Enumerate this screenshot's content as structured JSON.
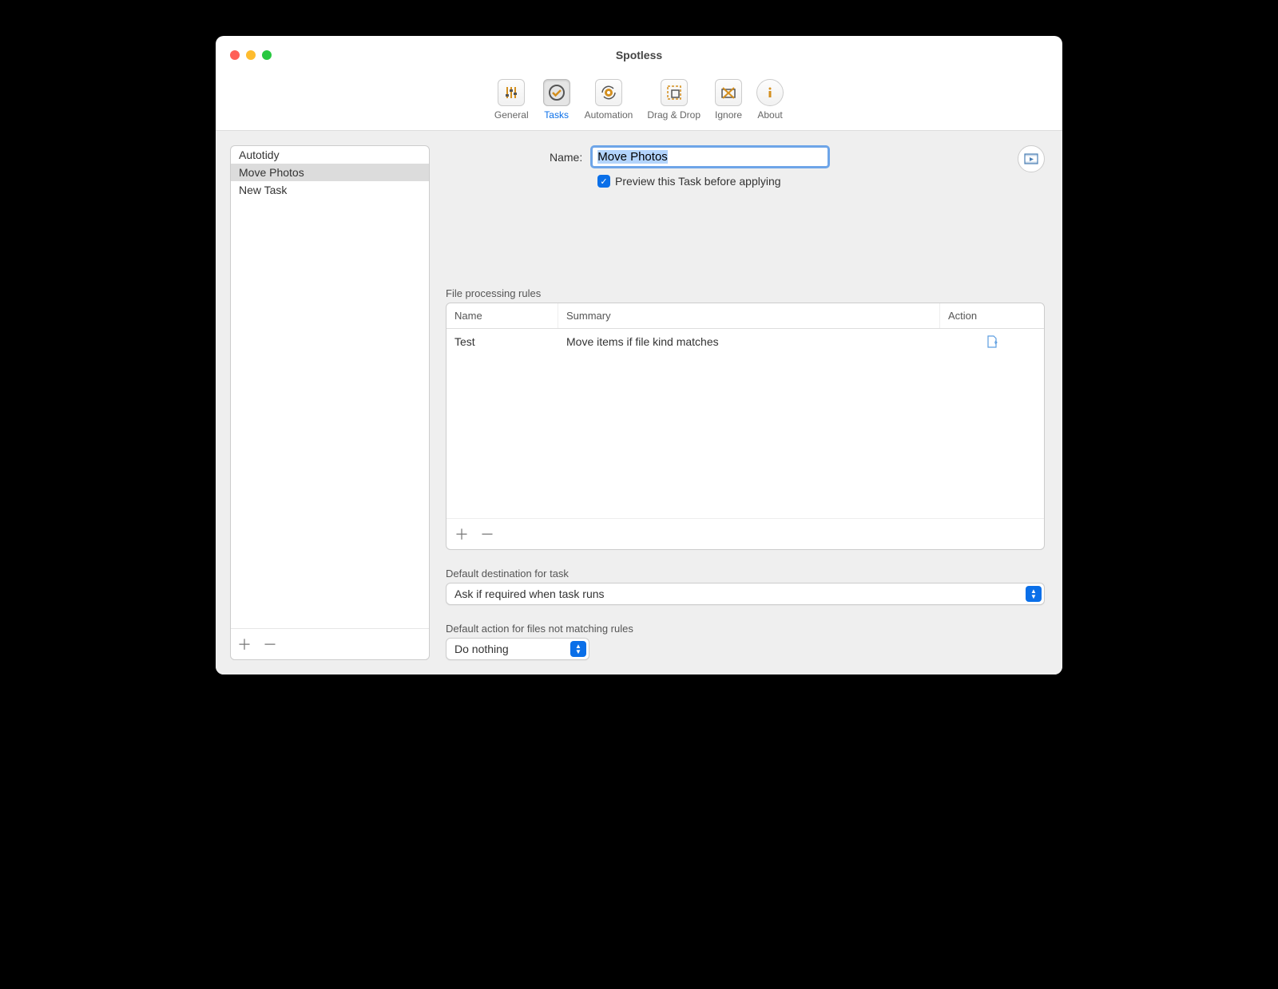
{
  "window": {
    "title": "Spotless"
  },
  "toolbar": {
    "items": [
      {
        "label": "General"
      },
      {
        "label": "Tasks"
      },
      {
        "label": "Automation"
      },
      {
        "label": "Drag & Drop"
      },
      {
        "label": "Ignore"
      },
      {
        "label": "About"
      }
    ],
    "selected_index": 1
  },
  "sidebar": {
    "items": [
      {
        "label": "Autotidy"
      },
      {
        "label": "Move Photos"
      },
      {
        "label": "New Task"
      }
    ],
    "selected_index": 1
  },
  "task": {
    "name_label": "Name:",
    "name_value": "Move Photos",
    "preview_checked": true,
    "preview_label": "Preview this Task before applying"
  },
  "rules": {
    "section_label": "File processing rules",
    "columns": {
      "name": "Name",
      "summary": "Summary",
      "action": "Action"
    },
    "rows": [
      {
        "name": "Test",
        "summary": "Move items if file kind matches"
      }
    ]
  },
  "destination": {
    "section_label": "Default destination for task",
    "value": "Ask if required when task runs"
  },
  "default_action": {
    "section_label": "Default action for files not matching rules",
    "value": "Do nothing"
  }
}
